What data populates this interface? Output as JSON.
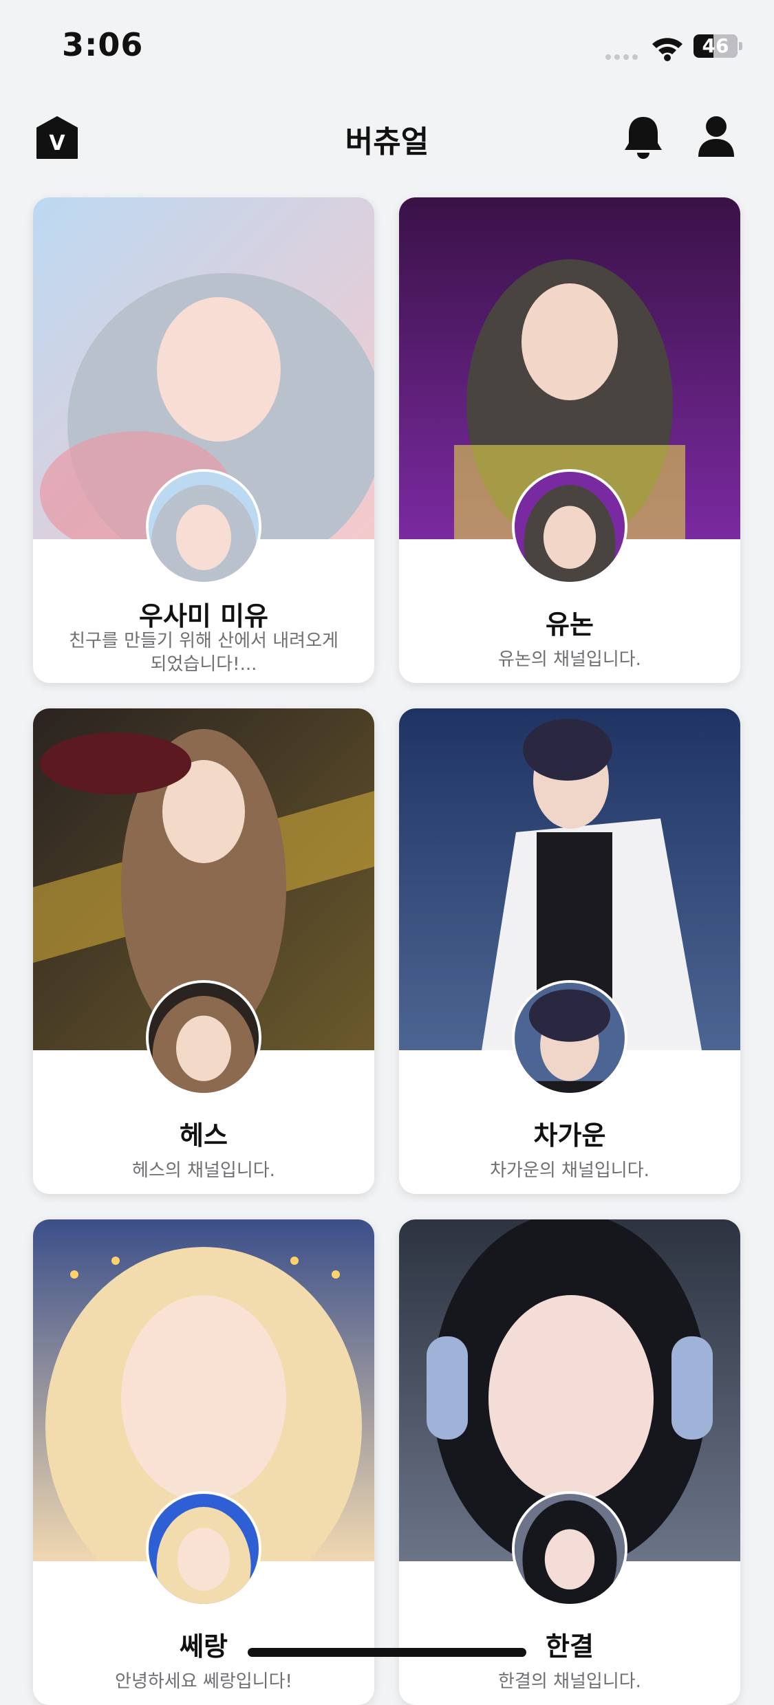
{
  "status": {
    "time": "3:06",
    "battery": "46",
    "battery_level": 0.46
  },
  "header": {
    "title": "버츄얼",
    "logo_letter": "V"
  },
  "cards": [
    {
      "name": "우사미 미유",
      "description": "친구를 만들기 위해 산에서 내려오게 되었습니다!...",
      "colors": {
        "bg1": "#bcd9f2",
        "bg2": "#f5c9cc",
        "hair": "#b9c2cc",
        "skin": "#f7ddd3",
        "accent": "#e79aa5"
      }
    },
    {
      "name": "유논",
      "description": "유논의 채널입니다.",
      "colors": {
        "bg1": "#3a1247",
        "bg2": "#7a2aa0",
        "hair": "#4a4440",
        "skin": "#f2d7c8",
        "accent": "#e2d34a"
      }
    },
    {
      "name": "헤스",
      "description": "헤스의 채널입니다.",
      "colors": {
        "bg1": "#2a2320",
        "bg2": "#6b5a2c",
        "hair": "#8b6a50",
        "skin": "#f3d9c8",
        "accent": "#d9b13a"
      }
    },
    {
      "name": "차가운",
      "description": "차가운의 채널입니다.",
      "colors": {
        "bg1": "#1f3463",
        "bg2": "#4d6592",
        "hair": "#2a2840",
        "skin": "#f0d6c8",
        "accent": "#f1f1f3"
      }
    },
    {
      "name": "쎄랑",
      "description": "안녕하세요 쎄랑입니다!",
      "colors": {
        "bg1": "#3b4f8a",
        "bg2": "#f0d8b0",
        "hair": "#f2dcae",
        "skin": "#f8e2d4",
        "accent": "#2e5fd4"
      }
    },
    {
      "name": "한결",
      "description": "한결의 채널입니다.",
      "colors": {
        "bg1": "#2d3340",
        "bg2": "#6b7488",
        "hair": "#16171d",
        "skin": "#f3ddd6",
        "accent": "#9fb3d9"
      }
    }
  ]
}
